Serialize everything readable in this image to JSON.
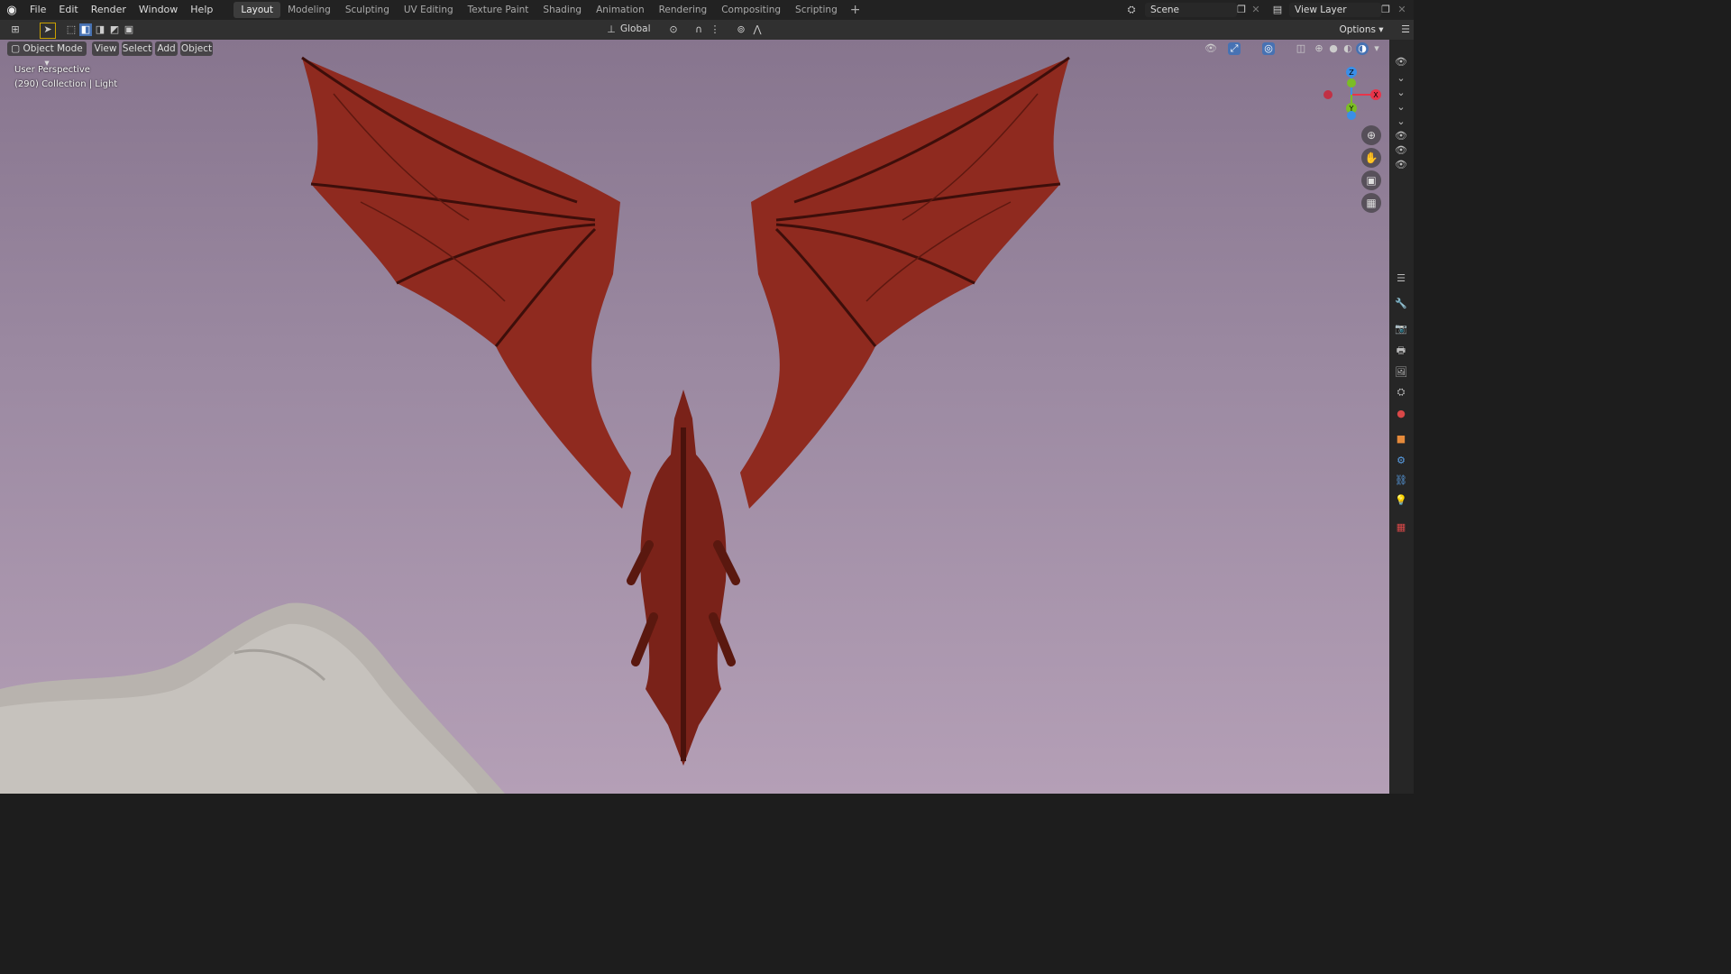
{
  "menu": [
    "File",
    "Edit",
    "Render",
    "Window",
    "Help"
  ],
  "workspaces": [
    "Layout",
    "Modeling",
    "Sculpting",
    "UV Editing",
    "Texture Paint",
    "Shading",
    "Animation",
    "Rendering",
    "Compositing",
    "Scripting"
  ],
  "active_workspace": "Layout",
  "scene": "Scene",
  "view_layer": "View Layer",
  "toolbar": {
    "transform_orientation": "Global",
    "options": "Options"
  },
  "viewport": {
    "mode": "Object Mode",
    "menus": [
      "View",
      "Select",
      "Add",
      "Object"
    ],
    "perspective_label": "User Perspective",
    "collection_label": "(290) Collection | Light",
    "gizmo": {
      "x": "X",
      "y": "Y",
      "z": "Z"
    }
  },
  "colors": {
    "accent": "#4772b3",
    "x_axis": "#e8354a",
    "y_axis": "#7bbd24",
    "z_axis": "#3a8fe8",
    "dragon": "#9a2a1e",
    "sky_top": "#87758e",
    "sky_bottom": "#b49fb6"
  }
}
